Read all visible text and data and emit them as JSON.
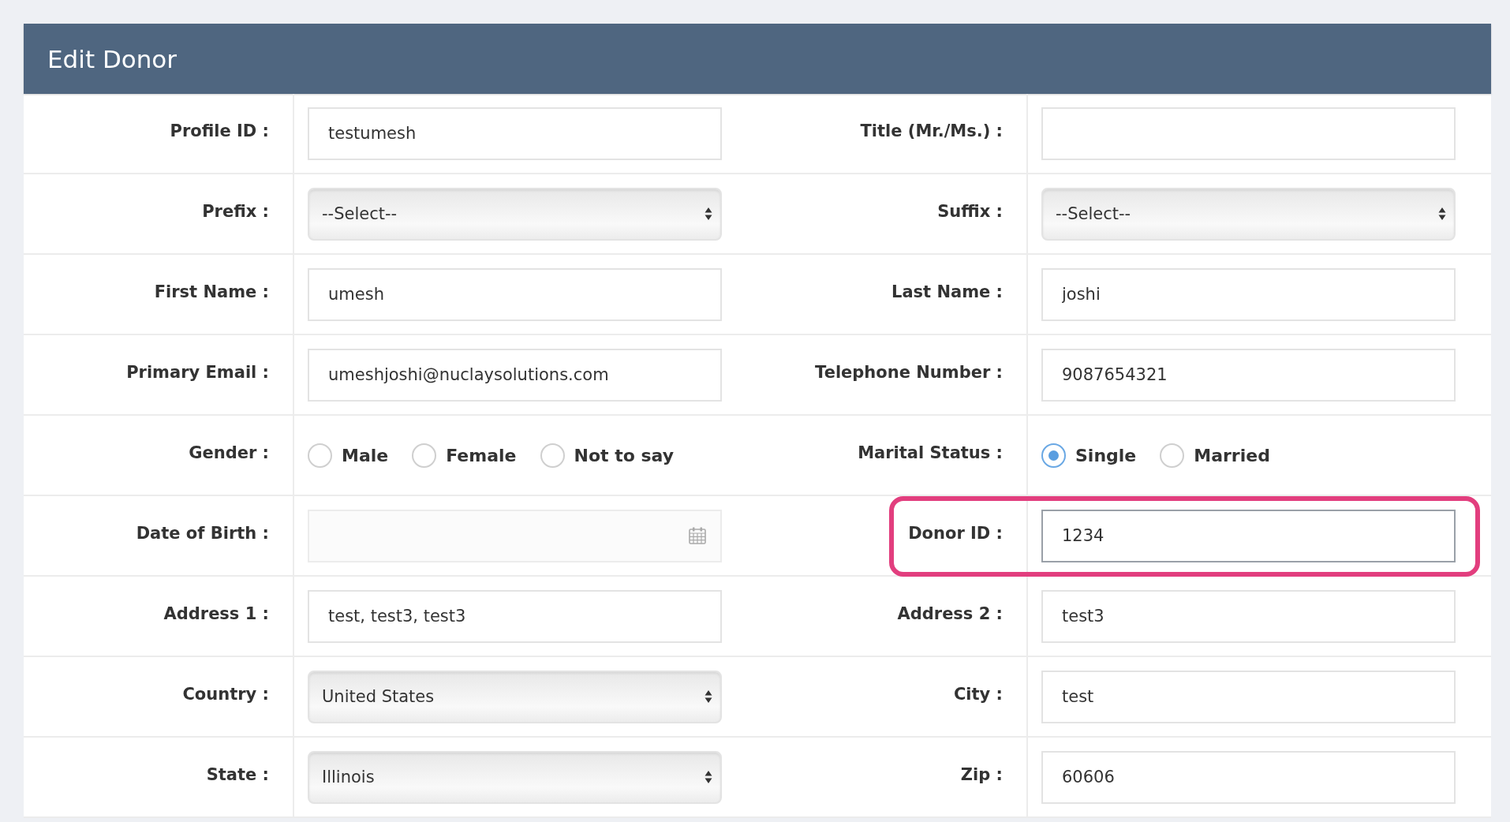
{
  "panel": {
    "title": "Edit Donor"
  },
  "rows": [
    {
      "cells": [
        {
          "label": "Profile ID :",
          "kind": "text",
          "value": "testumesh"
        },
        {
          "label": "Title (Mr./Ms.) :",
          "kind": "text"
        }
      ]
    },
    {
      "cells": [
        {
          "label": "Prefix :",
          "kind": "select",
          "value": "--Select--"
        },
        {
          "label": "Suffix :",
          "kind": "select",
          "value": "--Select--"
        }
      ]
    },
    {
      "cells": [
        {
          "label": "First Name :",
          "kind": "text",
          "value": "umesh"
        },
        {
          "label": "Last Name :",
          "kind": "text",
          "value": "joshi"
        }
      ]
    },
    {
      "cells": [
        {
          "label": "Primary Email :",
          "kind": "text",
          "value": "umeshjoshi@nuclaysolutions.com"
        },
        {
          "label": "Telephone Number :",
          "kind": "text",
          "value": "9087654321"
        }
      ]
    },
    {
      "cells": [
        {
          "label": "Gender :",
          "kind": "radio",
          "options": [
            {
              "label": "Male",
              "selected": false
            },
            {
              "label": "Female",
              "selected": false
            },
            {
              "label": "Not to say",
              "selected": false
            }
          ]
        },
        {
          "label": "Marital Status :",
          "kind": "radio",
          "options": [
            {
              "label": "Single",
              "selected": true
            },
            {
              "label": "Married",
              "selected": false
            }
          ]
        }
      ]
    },
    {
      "cells": [
        {
          "label": "Date of Birth :",
          "kind": "date"
        },
        {
          "label": "Donor ID :",
          "kind": "text",
          "value": "1234",
          "highlighted": true
        }
      ]
    },
    {
      "cells": [
        {
          "label": "Address 1 :",
          "kind": "text",
          "value": "test, test3, test3"
        },
        {
          "label": "Address 2 :",
          "kind": "text",
          "value": "test3"
        }
      ]
    },
    {
      "cells": [
        {
          "label": "Country :",
          "kind": "select",
          "value": "United States"
        },
        {
          "label": "City :",
          "kind": "text",
          "value": "test"
        }
      ]
    },
    {
      "cells": [
        {
          "label": "State :",
          "kind": "select",
          "value": "Illinois"
        },
        {
          "label": "Zip :",
          "kind": "text",
          "value": "60606"
        }
      ]
    }
  ]
}
